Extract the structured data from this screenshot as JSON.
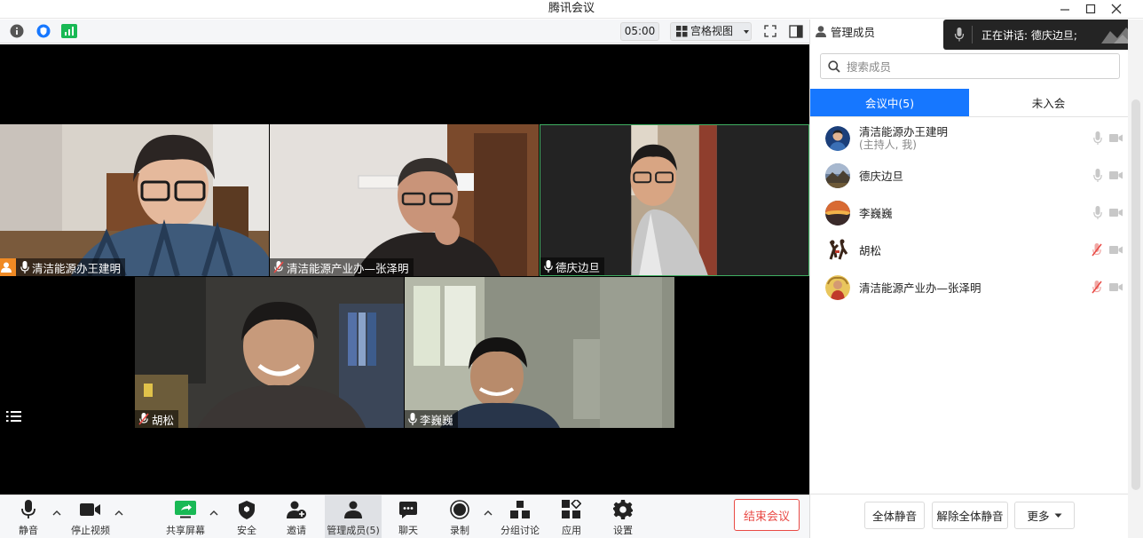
{
  "window": {
    "title": "腾讯会议"
  },
  "topbar": {
    "timer": "05:00",
    "view_label": "宫格视图"
  },
  "participants": [
    {
      "name": "清洁能源办王建明",
      "host": true,
      "muted": false
    },
    {
      "name": "清洁能源产业办—张泽明",
      "host": false,
      "muted": true
    },
    {
      "name": "德庆边旦",
      "host": false,
      "muted": false
    },
    {
      "name": "胡松",
      "host": false,
      "muted": true
    },
    {
      "name": "李巍巍",
      "host": false,
      "muted": false
    }
  ],
  "toolbar": {
    "mute": "静音",
    "stop_video": "停止视频",
    "share": "共享屏幕",
    "security": "安全",
    "invite": "邀请",
    "members": "管理成员(5)",
    "chat": "聊天",
    "record": "录制",
    "breakout": "分组讨论",
    "apps": "应用",
    "settings": "设置",
    "end": "结束会议"
  },
  "panel": {
    "title": "管理成员",
    "speaking": "正在讲话: 德庆边旦;",
    "search_placeholder": "搜索成员",
    "tabs": [
      "会议中(5)",
      "未入会"
    ],
    "members": [
      {
        "name": "清洁能源办王建明",
        "sub": "(主持人, 我)",
        "muted": false
      },
      {
        "name": "德庆边旦",
        "sub": "",
        "muted": false
      },
      {
        "name": "李巍巍",
        "sub": "",
        "muted": false
      },
      {
        "name": "胡松",
        "sub": "",
        "muted": true
      },
      {
        "name": "清洁能源产业办—张泽明",
        "sub": "",
        "muted": true
      }
    ],
    "footer": {
      "mute_all": "全体静音",
      "unmute_all": "解除全体静音",
      "more": "更多"
    }
  },
  "colors": {
    "accent": "#1677ff",
    "danger": "#e94a45",
    "host_badge": "#f08a24",
    "muted_mic": "#e94a45"
  }
}
